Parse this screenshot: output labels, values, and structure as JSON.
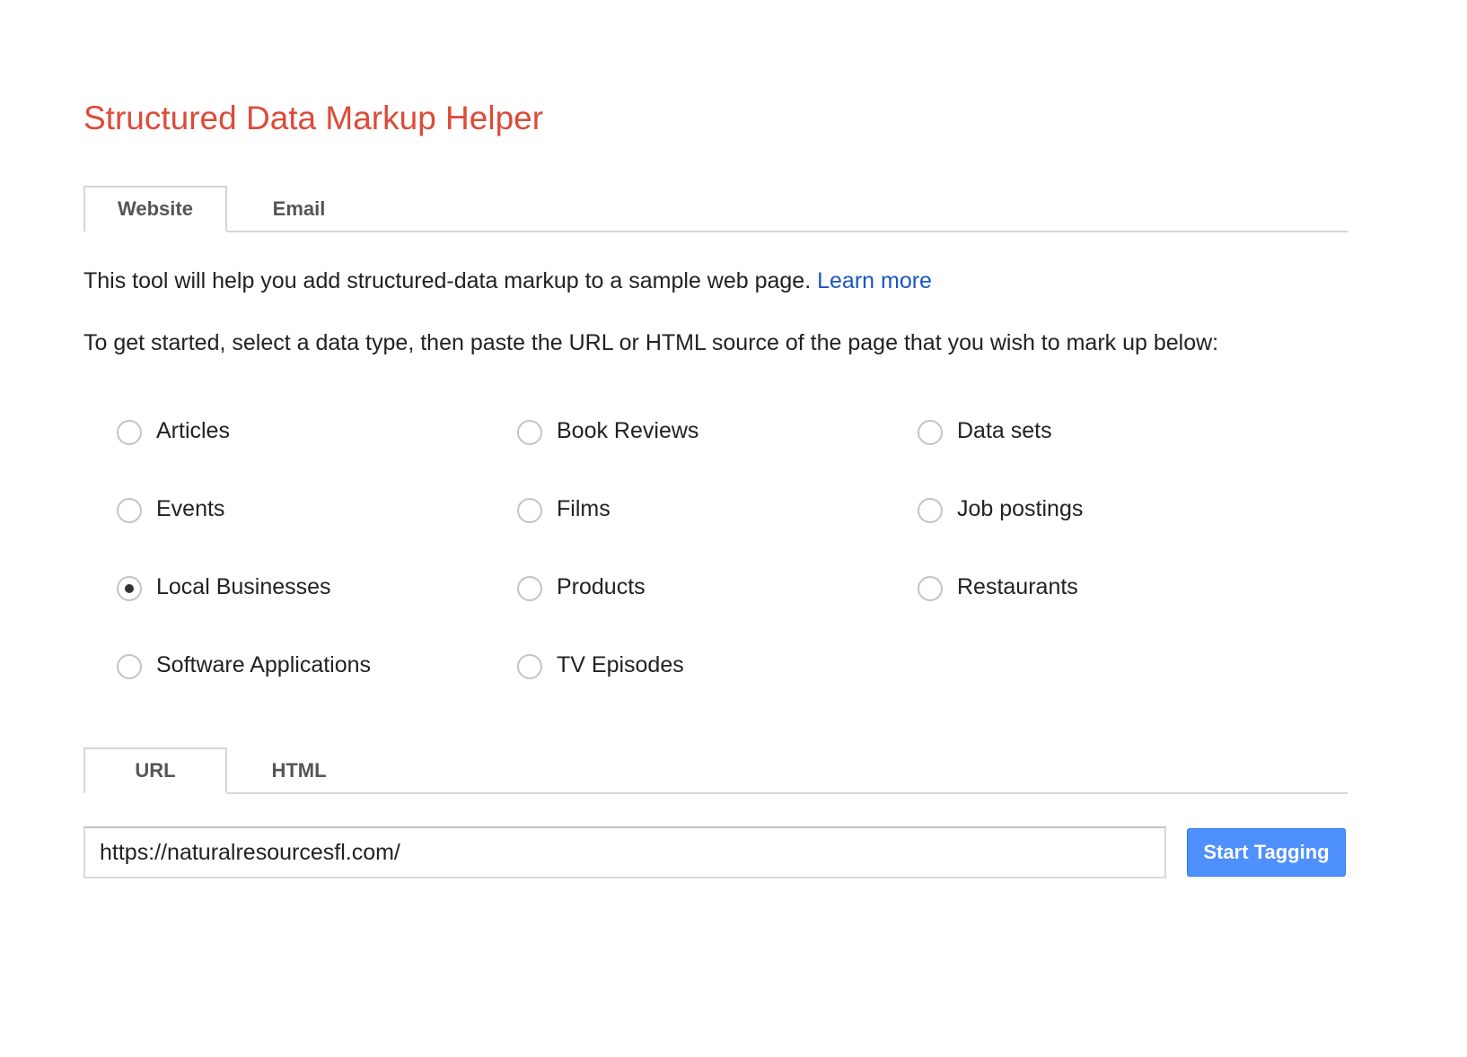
{
  "app": {
    "title": "Structured Data Markup Helper",
    "title_color": "#dd4b39"
  },
  "top_tabs": [
    {
      "label": "Website",
      "active": true
    },
    {
      "label": "Email",
      "active": false
    }
  ],
  "intro": {
    "text": "This tool will help you add structured-data markup to a sample web page.",
    "link_label": "Learn more",
    "link_color": "#1a55c4"
  },
  "instructions": "To get started, select a data type, then paste the URL or HTML source of the page that you wish to mark up below:",
  "data_types": [
    {
      "label": "Articles",
      "checked": false
    },
    {
      "label": "Book Reviews",
      "checked": false
    },
    {
      "label": "Data sets",
      "checked": false
    },
    {
      "label": "Events",
      "checked": false
    },
    {
      "label": "Films",
      "checked": false
    },
    {
      "label": "Job postings",
      "checked": false
    },
    {
      "label": "Local Businesses",
      "checked": true
    },
    {
      "label": "Products",
      "checked": false
    },
    {
      "label": "Restaurants",
      "checked": false
    },
    {
      "label": "Software Applications",
      "checked": false
    },
    {
      "label": "TV Episodes",
      "checked": false
    }
  ],
  "source_tabs": [
    {
      "label": "URL",
      "active": true
    },
    {
      "label": "HTML",
      "active": false
    }
  ],
  "url_input": {
    "value": "https://naturalresourcesfl.com/"
  },
  "start_button": {
    "label": "Start Tagging",
    "color": "#4d90fe"
  }
}
